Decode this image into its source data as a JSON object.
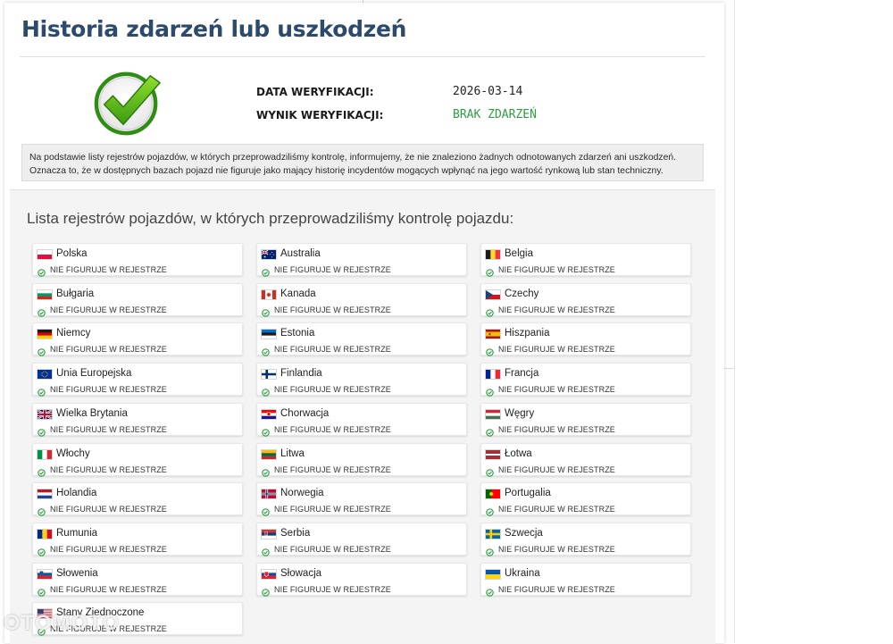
{
  "title": "Historia zdarzeń lub uszkodzeń",
  "verification": {
    "date_label": "DATA WERYFIKACJI:",
    "date_value": "2026-03-14",
    "result_label": "WYNIK WERYFIKACJI:",
    "result_value": "BRAK ZDARZEŃ",
    "result_color": "#2e9e43"
  },
  "info_text": "Na podstawie listy rejestrów pojazdów, w których przeprowadziliśmy kontrolę, informujemy, że nie znaleziono żadnych odnotowanych zdarzeń ani uszkodzeń. Oznacza to, że w dostępnych bazach pojazd nie figuruje jako mający historię incydentów mogących wpłynąć na jego wartość rynkową lub stan techniczny.",
  "list_title": "Lista rejestrów pojazdów, w których przeprowadziliśmy kontrolę pojazdu:",
  "status_icon": "check-circle-icon",
  "status_color": "#2e9e43",
  "registers": [
    {
      "country": "Polska",
      "status": "NIE FIGURUJE W REJESTRZE",
      "flag": "pl"
    },
    {
      "country": "Australia",
      "status": "NIE FIGURUJE W REJESTRZE",
      "flag": "au"
    },
    {
      "country": "Belgia",
      "status": "NIE FIGURUJE W REJESTRZE",
      "flag": "be"
    },
    {
      "country": "Bułgaria",
      "status": "NIE FIGURUJE W REJESTRZE",
      "flag": "bg"
    },
    {
      "country": "Kanada",
      "status": "NIE FIGURUJE W REJESTRZE",
      "flag": "ca"
    },
    {
      "country": "Czechy",
      "status": "NIE FIGURUJE W REJESTRZE",
      "flag": "cz"
    },
    {
      "country": "Niemcy",
      "status": "NIE FIGURUJE W REJESTRZE",
      "flag": "de"
    },
    {
      "country": "Estonia",
      "status": "NIE FIGURUJE W REJESTRZE",
      "flag": "ee"
    },
    {
      "country": "Hiszpania",
      "status": "NIE FIGURUJE W REJESTRZE",
      "flag": "es"
    },
    {
      "country": "Unia Europejska",
      "status": "NIE FIGURUJE W REJESTRZE",
      "flag": "eu"
    },
    {
      "country": "Finlandia",
      "status": "NIE FIGURUJE W REJESTRZE",
      "flag": "fi"
    },
    {
      "country": "Francja",
      "status": "NIE FIGURUJE W REJESTRZE",
      "flag": "fr"
    },
    {
      "country": "Wielka Brytania",
      "status": "NIE FIGURUJE W REJESTRZE",
      "flag": "gb"
    },
    {
      "country": "Chorwacja",
      "status": "NIE FIGURUJE W REJESTRZE",
      "flag": "hr"
    },
    {
      "country": "Węgry",
      "status": "NIE FIGURUJE W REJESTRZE",
      "flag": "hu"
    },
    {
      "country": "Włochy",
      "status": "NIE FIGURUJE W REJESTRZE",
      "flag": "it"
    },
    {
      "country": "Litwa",
      "status": "NIE FIGURUJE W REJESTRZE",
      "flag": "lt"
    },
    {
      "country": "Łotwa",
      "status": "NIE FIGURUJE W REJESTRZE",
      "flag": "lv"
    },
    {
      "country": "Holandia",
      "status": "NIE FIGURUJE W REJESTRZE",
      "flag": "nl"
    },
    {
      "country": "Norwegia",
      "status": "NIE FIGURUJE W REJESTRZE",
      "flag": "no"
    },
    {
      "country": "Portugalia",
      "status": "NIE FIGURUJE W REJESTRZE",
      "flag": "pt"
    },
    {
      "country": "Rumunia",
      "status": "NIE FIGURUJE W REJESTRZE",
      "flag": "ro"
    },
    {
      "country": "Serbia",
      "status": "NIE FIGURUJE W REJESTRZE",
      "flag": "rs"
    },
    {
      "country": "Szwecja",
      "status": "NIE FIGURUJE W REJESTRZE",
      "flag": "se"
    },
    {
      "country": "Słowenia",
      "status": "NIE FIGURUJE W REJESTRZE",
      "flag": "si"
    },
    {
      "country": "Słowacja",
      "status": "NIE FIGURUJE W REJESTRZE",
      "flag": "sk"
    },
    {
      "country": "Ukraina",
      "status": "NIE FIGURUJE W REJESTRZE",
      "flag": "ua"
    },
    {
      "country": "Stany Zjednoczone",
      "status": "NIE FIGURUJE W REJESTRZE",
      "flag": "us"
    }
  ],
  "watermark": "OTOMOTO"
}
